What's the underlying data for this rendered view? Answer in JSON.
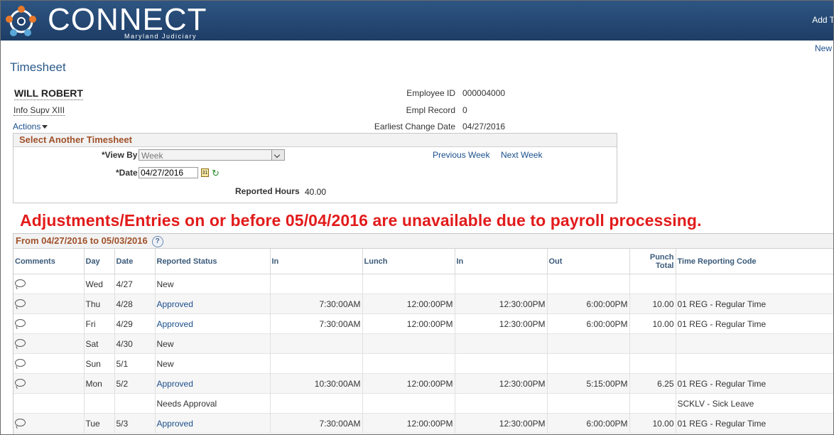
{
  "header": {
    "logo_text": "CONNECT",
    "logo_sub": "Maryland Judiciary",
    "right_link": "Add T",
    "new_link": "New"
  },
  "page": {
    "title": "Timesheet"
  },
  "employee": {
    "name": "WILL ROBERT",
    "job_title": "Info Supv XIII",
    "actions_label": "Actions",
    "id_label": "Employee ID",
    "id_value": "000004000",
    "record_label": "Empl Record",
    "record_value": "0",
    "change_label": "Earliest Change Date",
    "change_value": "04/27/2016"
  },
  "select_timesheet": {
    "title": "Select Another Timesheet",
    "view_by_label": "*View By",
    "view_by_value": "Week",
    "date_label": "*Date",
    "date_value": "04/27/2016",
    "previous_week": "Previous Week",
    "next_week": "Next Week",
    "reported_hours_label": "Reported Hours",
    "reported_hours_value": "40.00"
  },
  "warning": "Adjustments/Entries on or before 05/04/2016 are unavailable due to payroll processing.",
  "grid": {
    "title": "From 04/27/2016 to 05/03/2016",
    "help": "?",
    "columns": [
      "Comments",
      "Day",
      "Date",
      "Reported Status",
      "In",
      "Lunch",
      "In",
      "Out",
      "Punch",
      "Total",
      "Time Reporting Code"
    ],
    "rows": [
      {
        "comment": true,
        "day": "Wed",
        "date": "4/27",
        "status": "New",
        "status_link": false,
        "in1": "",
        "lunch": "",
        "in2": "",
        "out": "",
        "total": "",
        "trc": ""
      },
      {
        "comment": true,
        "day": "Thu",
        "date": "4/28",
        "status": "Approved",
        "status_link": true,
        "in1": "7:30:00AM",
        "lunch": "12:00:00PM",
        "in2": "12:30:00PM",
        "out": "6:00:00PM",
        "total": "10.00",
        "trc": "01 REG - Regular Time"
      },
      {
        "comment": true,
        "day": "Fri",
        "date": "4/29",
        "status": "Approved",
        "status_link": true,
        "in1": "7:30:00AM",
        "lunch": "12:00:00PM",
        "in2": "12:30:00PM",
        "out": "6:00:00PM",
        "total": "10.00",
        "trc": "01 REG - Regular Time"
      },
      {
        "comment": true,
        "day": "Sat",
        "date": "4/30",
        "status": "New",
        "status_link": false,
        "in1": "",
        "lunch": "",
        "in2": "",
        "out": "",
        "total": "",
        "trc": ""
      },
      {
        "comment": true,
        "day": "Sun",
        "date": "5/1",
        "status": "New",
        "status_link": false,
        "in1": "",
        "lunch": "",
        "in2": "",
        "out": "",
        "total": "",
        "trc": ""
      },
      {
        "comment": true,
        "day": "Mon",
        "date": "5/2",
        "status": "Approved",
        "status_link": true,
        "in1": "10:30:00AM",
        "lunch": "12:00:00PM",
        "in2": "12:30:00PM",
        "out": "5:15:00PM",
        "total": "6.25",
        "trc": "01 REG - Regular Time"
      },
      {
        "comment": false,
        "day": "",
        "date": "",
        "status": "Needs Approval",
        "status_link": false,
        "in1": "",
        "lunch": "",
        "in2": "",
        "out": "",
        "total": "",
        "trc": "SCKLV - Sick Leave"
      },
      {
        "comment": true,
        "day": "Tue",
        "date": "5/3",
        "status": "Approved",
        "status_link": true,
        "in1": "7:30:00AM",
        "lunch": "12:00:00PM",
        "in2": "12:30:00PM",
        "out": "6:00:00PM",
        "total": "10.00",
        "trc": "01 REG - Regular Time"
      }
    ]
  }
}
